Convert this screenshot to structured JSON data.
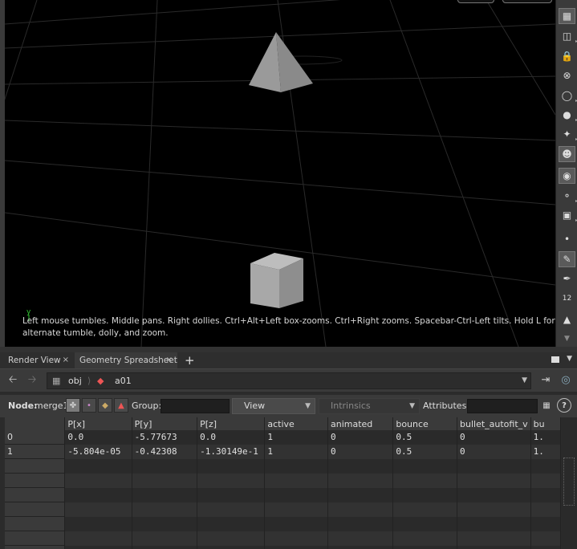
{
  "viewport": {
    "hint_text": "Left mouse tumbles. Middle pans. Right dollies. Ctrl+Alt+Left box-zooms. Ctrl+Right zooms. Spacebar-Ctrl-Left tilts. Hold L for alternate tumble, dolly, and zoom.",
    "axis_label": "y"
  },
  "right_toolbar": {
    "icons": [
      "show-handle-icon",
      "snapshot-icon",
      "lock-icon",
      "close-circle-icon",
      "light-bulb-icon",
      "light-icon",
      "light-add-icon",
      "display-mode-icon",
      "shaded-icon",
      "camera-icon",
      "camera-capture-icon",
      "point-icon",
      "brush-icon",
      "pen-icon",
      "number-icon",
      "eraser-icon",
      "down-arrow-icon"
    ],
    "number_label": "12"
  },
  "tabs": [
    {
      "label": "Render View",
      "close": "×"
    },
    {
      "label": "Geometry Spreadsheet",
      "close": "×"
    }
  ],
  "add_tab": "+",
  "path": {
    "segments": [
      "obj",
      "a01"
    ]
  },
  "options": {
    "node_label": "Node:",
    "node_value": "merge1",
    "group_label": "Group:",
    "view_label": "View",
    "intrinsics_label": "Intrinsics",
    "attributes_label": "Attributes:",
    "help": "?"
  },
  "spreadsheet": {
    "columns": [
      "",
      "P[x]",
      "P[y]",
      "P[z]",
      "active",
      "animated",
      "bounce",
      "bullet_autofit_v",
      "bu"
    ],
    "rows": [
      [
        "0",
        "0.0",
        "-5.77673",
        "0.0",
        "1",
        "0",
        "0.5",
        "0",
        "1."
      ],
      [
        "1",
        "-5.804e-05",
        "-0.42308",
        "-1.30149e-1",
        "1",
        "0",
        "0.5",
        "0",
        "1."
      ]
    ]
  },
  "colors": {
    "viewport_bg": "#000000",
    "panel_bg": "#3a3a3a",
    "object_gray": "#9a9a9a"
  }
}
